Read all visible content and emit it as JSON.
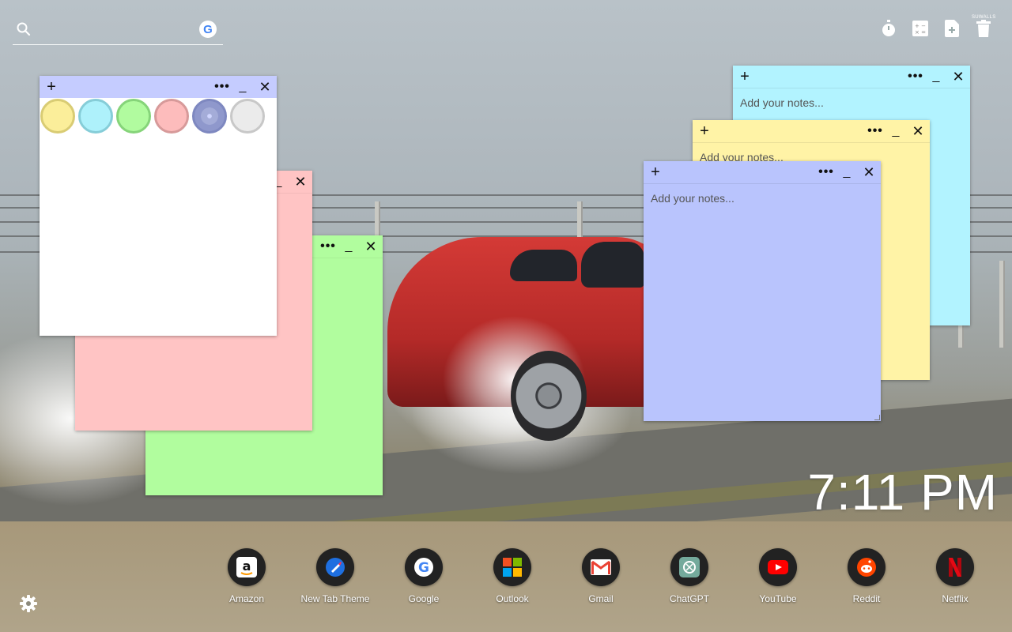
{
  "search": {
    "placeholder": "",
    "icon": "search-icon",
    "engine_icon": "google-icon"
  },
  "toolbar": {
    "tools": [
      "timer-icon",
      "calculator-icon",
      "notes-add-icon",
      "trash-icon"
    ],
    "brand": "SUWALLS"
  },
  "notes": {
    "placeholder": "Add your notes...",
    "add_glyph": "+",
    "more_glyph": "•••",
    "min_glyph": "_",
    "close_glyph": "✕",
    "colors": {
      "white": "#ffffff",
      "pink": "#ffc4c4",
      "green": "#b1fd9e",
      "cyan": "#b2f3ff",
      "yellow": "#fff3a6",
      "blue": "#b9c4fd",
      "header_blue": "#c5ccff"
    }
  },
  "palette": [
    {
      "name": "yellow",
      "fill": "#fbee9a",
      "ring": "#d9cc74"
    },
    {
      "name": "cyan",
      "fill": "#aef1fb",
      "ring": "#86cdd8"
    },
    {
      "name": "green",
      "fill": "#b1fb9f",
      "ring": "#86d47a"
    },
    {
      "name": "pink",
      "fill": "#fdbcbc",
      "ring": "#d79a9a"
    },
    {
      "name": "blue",
      "fill": "#a4acd8",
      "ring": "#7e88c0",
      "selected": true
    },
    {
      "name": "gray",
      "fill": "#ebebeb",
      "ring": "#c8c8c8"
    }
  ],
  "clock": {
    "time": "7:11 PM"
  },
  "shortcuts": [
    {
      "label": "Amazon",
      "icon": "amazon-icon"
    },
    {
      "label": "New Tab Theme",
      "icon": "new-tab-theme-icon"
    },
    {
      "label": "Google",
      "icon": "google-icon"
    },
    {
      "label": "Outlook",
      "icon": "outlook-icon"
    },
    {
      "label": "Gmail",
      "icon": "gmail-icon"
    },
    {
      "label": "ChatGPT",
      "icon": "chatgpt-icon"
    },
    {
      "label": "YouTube",
      "icon": "youtube-icon"
    },
    {
      "label": "Reddit",
      "icon": "reddit-icon"
    },
    {
      "label": "Netflix",
      "icon": "netflix-icon"
    }
  ],
  "settings": {
    "icon": "gear-icon"
  }
}
